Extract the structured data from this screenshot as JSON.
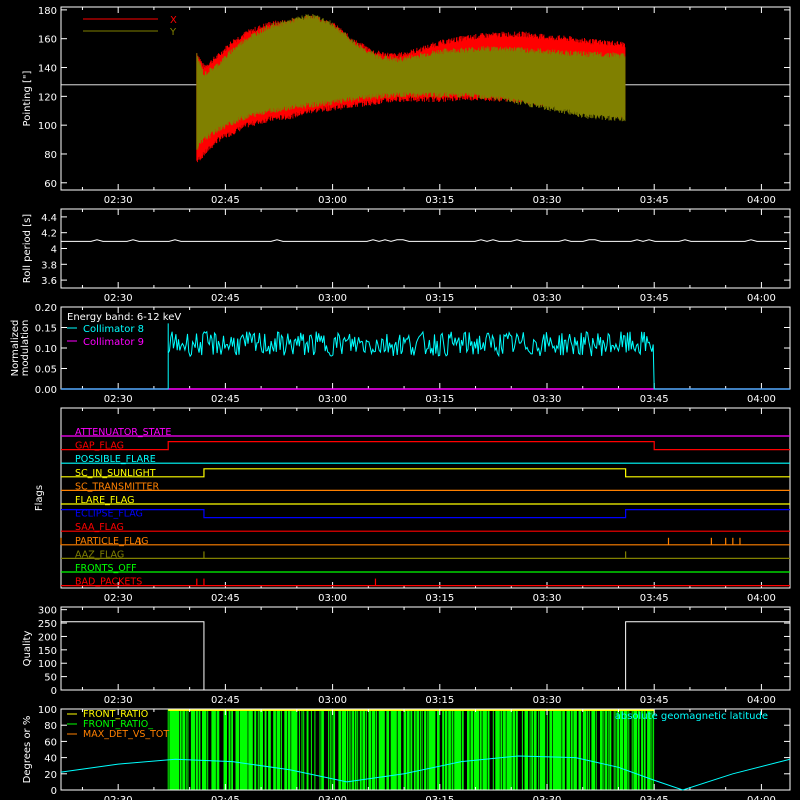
{
  "colors": {
    "background": "#000000",
    "axis": "#ffffff",
    "red": "#ff0000",
    "olive": "#808000",
    "cyan": "#00ffff",
    "magenta": "#ff00ff",
    "green": "#00ff00",
    "orange": "#ff8000",
    "yellow": "#ffff00",
    "blue": "#0000ff",
    "white": "#ffffff"
  },
  "time_ticks": [
    "02:30",
    "02:45",
    "03:00",
    "03:15",
    "03:30",
    "03:45",
    "04:00"
  ],
  "chart_data": [
    {
      "id": "pointing",
      "type": "line",
      "ylabel": "Pointing [\"]",
      "ylim": [
        55,
        182
      ],
      "yticks": [
        60,
        80,
        100,
        120,
        140,
        160,
        180
      ],
      "xlim": [
        "02:22",
        "04:04"
      ],
      "reference_line": 128,
      "legend": [
        {
          "name": "X",
          "color": "red"
        },
        {
          "name": "Y",
          "color": "olive"
        }
      ],
      "x": [
        "02:41",
        "02:42",
        "02:44",
        "02:46",
        "02:48",
        "02:51",
        "02:54",
        "02:57",
        "03:00",
        "03:03",
        "03:06",
        "03:09",
        "03:12",
        "03:15",
        "03:18",
        "03:21",
        "03:24",
        "03:27",
        "03:30",
        "03:33",
        "03:36",
        "03:39",
        "03:41"
      ],
      "series": [
        {
          "name": "X",
          "color": "red",
          "upper": [
            150,
            140,
            148,
            158,
            164,
            170,
            172,
            175,
            170,
            158,
            150,
            148,
            152,
            157,
            160,
            162,
            163,
            163,
            161,
            160,
            158,
            157,
            156
          ],
          "lower": [
            75,
            80,
            90,
            95,
            100,
            104,
            106,
            110,
            112,
            114,
            116,
            118,
            118,
            118,
            119,
            119,
            118,
            117,
            115,
            113,
            110,
            108,
            107
          ]
        },
        {
          "name": "Y",
          "color": "olive",
          "upper": [
            148,
            135,
            142,
            152,
            160,
            168,
            172,
            176,
            170,
            157,
            148,
            145,
            148,
            151,
            152,
            153,
            153,
            152,
            151,
            150,
            149,
            149,
            148
          ],
          "lower": [
            84,
            90,
            97,
            102,
            106,
            110,
            112,
            114,
            116,
            118,
            120,
            121,
            121,
            121,
            121,
            120,
            118,
            115,
            112,
            109,
            106,
            105,
            104
          ]
        }
      ]
    },
    {
      "id": "roll-period",
      "type": "line",
      "ylabel": "Roll period [s]",
      "ylim": [
        3.5,
        4.5
      ],
      "yticks": [
        3.6,
        3.8,
        4.0,
        4.2,
        4.4
      ],
      "xlim": [
        "02:22",
        "04:04"
      ],
      "x": [
        "02:22",
        "04:04"
      ],
      "series": [
        {
          "name": "",
          "color": "white",
          "values": [
            4.09,
            4.09
          ]
        }
      ]
    },
    {
      "id": "modulation",
      "type": "line",
      "ylabel": "Normalized modulation",
      "ylim": [
        0.0,
        0.2
      ],
      "yticks": [
        "0.00",
        "0.05",
        "0.10",
        "0.15",
        "0.20"
      ],
      "xlim": [
        "02:22",
        "04:04"
      ],
      "annotation": "Energy band: 6-12 keV",
      "series": [
        {
          "name": "Collimator 8",
          "color": "cyan",
          "start": "02:37",
          "end": "03:45",
          "base": 0.11,
          "spread": 0.03
        },
        {
          "name": "Collimator 9",
          "color": "magenta",
          "values_constant": 0.0
        }
      ]
    },
    {
      "id": "flags",
      "type": "line",
      "ylabel": "Flags",
      "xlim": [
        "02:22",
        "04:04"
      ],
      "series": [
        {
          "name": "ATTENUATOR_STATE",
          "color": "magenta",
          "steps": []
        },
        {
          "name": "GAP_FLAG",
          "color": "red",
          "steps": [
            [
              "02:37",
              1
            ],
            [
              "03:45",
              0
            ]
          ],
          "initial": 0,
          "alt": 1
        },
        {
          "name": "POSSIBLE_FLARE",
          "color": "cyan",
          "steps": []
        },
        {
          "name": "SC_IN_SUNLIGHT",
          "color": "yellow",
          "steps": [
            [
              "02:42",
              1
            ],
            [
              "03:41",
              0
            ]
          ],
          "initial": 0
        },
        {
          "name": "SC_TRANSMITTER",
          "color": "orange",
          "steps": []
        },
        {
          "name": "FLARE_FLAG",
          "color": "yellow",
          "steps": []
        },
        {
          "name": "ECLIPSE_FLAG",
          "color": "blue",
          "steps": [
            [
              "02:42",
              0
            ],
            [
              "03:41",
              1
            ]
          ],
          "initial": 1
        },
        {
          "name": "SAA_FLAG",
          "color": "red",
          "steps": []
        },
        {
          "name": "PARTICLE_FLAG",
          "color": "orange",
          "spikes": [
            "02:22",
            "02:33",
            "03:47",
            "03:53",
            "03:55",
            "03:56",
            "03:57"
          ]
        },
        {
          "name": "AAZ_FLAG",
          "color": "olive",
          "spikes": [
            "02:42",
            "03:41"
          ]
        },
        {
          "name": "FRONTS_OFF",
          "color": "green",
          "steps": []
        },
        {
          "name": "BAD_PACKETS",
          "color": "red",
          "spikes": [
            "02:41",
            "02:42",
            "03:06"
          ]
        }
      ]
    },
    {
      "id": "quality",
      "type": "line",
      "ylabel": "Quality",
      "ylim": [
        0,
        310
      ],
      "yticks": [
        0,
        50,
        100,
        150,
        200,
        250,
        300
      ],
      "xlim": [
        "02:22",
        "04:04"
      ],
      "x": [
        "02:22",
        "02:42",
        "02:42",
        "03:41",
        "03:41",
        "04:04"
      ],
      "series": [
        {
          "name": "",
          "color": "white",
          "values": [
            255,
            255,
            0,
            0,
            255,
            255
          ]
        }
      ]
    },
    {
      "id": "geomagnetic",
      "type": "line",
      "ylabel": "Degrees or %",
      "ylim": [
        0,
        100
      ],
      "yticks": [
        0,
        20,
        40,
        60,
        80,
        100
      ],
      "xlim": [
        "02:22",
        "04:04"
      ],
      "legend": [
        {
          "name": "FRONT_RATIO",
          "color": "yellow"
        },
        {
          "name": "FRONT_RATIO_",
          "color": "green"
        },
        {
          "name": "MAX_DET_VS_TOT",
          "color": "orange"
        }
      ],
      "annotation": "absolute geomagnetic latitude",
      "band": {
        "start": "02:37",
        "end": "03:45",
        "color": "green"
      },
      "x": [
        "02:22",
        "02:30",
        "02:38",
        "02:46",
        "02:54",
        "03:02",
        "03:10",
        "03:18",
        "03:26",
        "03:34",
        "03:40",
        "03:45",
        "03:49",
        "03:56",
        "04:04"
      ],
      "series": [
        {
          "name": "absolute geomagnetic latitude",
          "color": "cyan",
          "values": [
            22,
            32,
            38,
            35,
            25,
            10,
            20,
            35,
            42,
            40,
            28,
            12,
            0,
            20,
            38
          ]
        }
      ]
    }
  ]
}
